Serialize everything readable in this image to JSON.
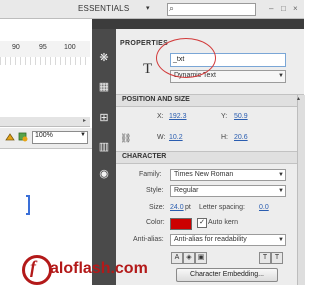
{
  "topbar": {
    "workspace": "ESSENTIALS",
    "caret": "▾",
    "search_icon": "⌕",
    "minimize": "–",
    "restore": "□",
    "close": "×"
  },
  "timeline": {
    "ruler_numbers": [
      "90",
      "95",
      "100"
    ]
  },
  "stage_toolbar": {
    "zoom": "100%"
  },
  "properties": {
    "tab": "PROPERTIES",
    "instance_name": "_txt",
    "text_type": "Dynamic Text",
    "position_size": {
      "title": "POSITION AND SIZE",
      "x_label": "X:",
      "x": "192.3",
      "y_label": "Y:",
      "y": "50.9",
      "w_label": "W:",
      "w": "10.2",
      "h_label": "H:",
      "h": "20.6"
    },
    "character": {
      "title": "CHARACTER",
      "family_label": "Family:",
      "family": "Times New Roman",
      "style_label": "Style:",
      "style": "Regular",
      "size_label": "Size:",
      "size": "24.0",
      "size_unit": "pt",
      "spacing_label": "Letter spacing:",
      "spacing": "0.0",
      "color_label": "Color:",
      "color": "#cc0000",
      "autokern_label": "Auto kern",
      "autokern_checked": true,
      "antialias_label": "Anti-alias:",
      "antialias": "Anti-alias for readability",
      "embed_button": "Character Embedding..."
    }
  },
  "watermark": {
    "letter": "f",
    "text": "aloflash.com"
  }
}
